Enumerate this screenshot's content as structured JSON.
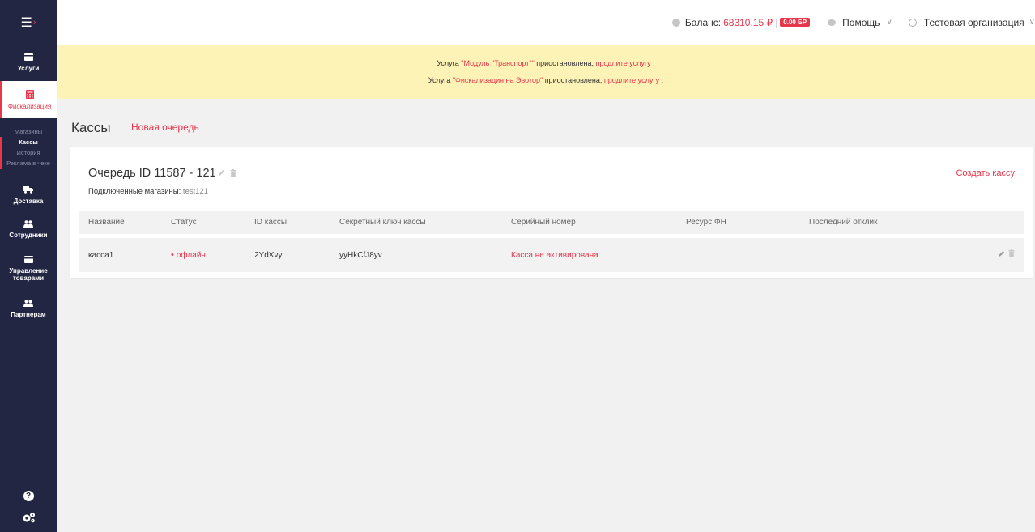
{
  "sidebar": {
    "items": [
      {
        "label": "Услуги"
      },
      {
        "label": "Фискализация"
      },
      {
        "label": "Доставка"
      },
      {
        "label": "Сотрудники"
      },
      {
        "label": "Управление товарами"
      },
      {
        "label": "Партнерам"
      }
    ],
    "submenu": [
      "Магазины",
      "Кассы",
      "История",
      "Реклама в чеке"
    ]
  },
  "topbar": {
    "balance_label": "Баланс:",
    "balance_value": "68310.15 ₽",
    "balance_sep": "|",
    "bonus_badge": "0.00 БР",
    "help_label": "Помощь",
    "org_label": "Тестовая организация"
  },
  "banner": {
    "line1": {
      "pre": "Услуга ",
      "service": "\"Модуль \"Транспорт\"\"",
      "mid": " приостановлена, ",
      "link": "продлите услугу",
      "post": " ."
    },
    "line2": {
      "pre": "Услуга ",
      "service": "\"Фискализация на Эвотор\"",
      "mid": " приостановлена, ",
      "link": "продлите услугу",
      "post": " ."
    }
  },
  "page": {
    "title": "Кассы",
    "new_queue_link": "Новая очередь"
  },
  "queue": {
    "title": "Очередь ID 11587 - 121",
    "stores_label": "Подключенные магазины:",
    "stores_value": " test121",
    "create_link": "Создать кассу",
    "columns": [
      "Название",
      "Статус",
      "ID кассы",
      "Секретный ключ кассы",
      "Серийный номер",
      "Ресурс ФН",
      "Последний отклик"
    ],
    "rows": [
      {
        "name": "касса1",
        "status": "офлайн",
        "id": "2YdXvy",
        "secret": "yyHkCfJ8yv",
        "serial": "Касса не активирована",
        "resource": "",
        "last": ""
      }
    ]
  },
  "colors": {
    "accent": "#e8364b",
    "sidebar": "#232642",
    "banner": "#fef3b7"
  }
}
